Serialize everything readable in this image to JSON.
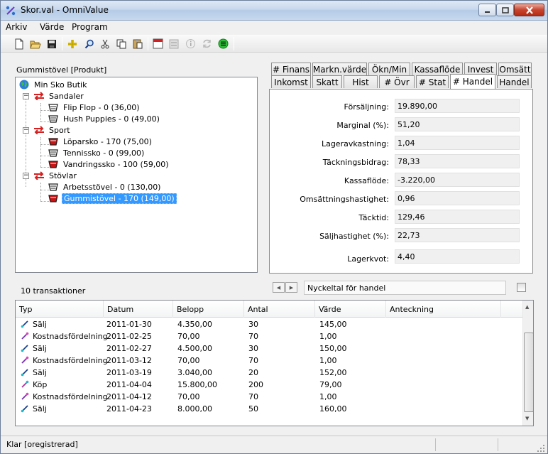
{
  "window": {
    "title": "Skor.val - OmniValue"
  },
  "menu": [
    "Arkiv",
    "Värde",
    "Program"
  ],
  "tree": {
    "caption": "Gummistövel  [Produkt]",
    "root": "Min Sko Butik",
    "groups": [
      {
        "label": "Sandaler",
        "items": [
          "Flip Flop - 0 (36,00)",
          "Hush Puppies - 0 (49,00)"
        ]
      },
      {
        "label": "Sport",
        "items": [
          "Löparsko - 170 (75,00)",
          "Tennissko - 0 (99,00)",
          "Vandringssko - 100 (59,00)"
        ]
      },
      {
        "label": "Stövlar",
        "items": [
          "Arbetsstövel - 0 (130,00)",
          "Gummistövel - 170 (149,00)"
        ]
      }
    ]
  },
  "tabs": {
    "row1": [
      "# Finans",
      "Markn.värde",
      "Ökn/Min",
      "Kassaflöde",
      "Invest",
      "Omsätt"
    ],
    "row2": [
      "Inkomst",
      "Skatt",
      "Hist",
      "# Övr",
      "# Stat",
      "# Handel",
      "Handel"
    ],
    "active": "# Handel"
  },
  "metrics": [
    {
      "label": "Försäljning:",
      "value": "19.890,00"
    },
    {
      "label": "Marginal (%):",
      "value": "51,20"
    },
    {
      "label": "Lageravkastning:",
      "value": "1,04"
    },
    {
      "label": "Täckningsbidrag:",
      "value": "78,33"
    },
    {
      "label": "Kassaflöde:",
      "value": "-3.220,00"
    },
    {
      "label": "Omsättningshastighet:",
      "value": "0,96"
    },
    {
      "label": "Täcktid:",
      "value": "129,46"
    },
    {
      "label": "Säljhastighet (%):",
      "value": "22,73"
    },
    {
      "label": "Lagerkvot:",
      "value": "4,40"
    }
  ],
  "transactions": {
    "count_label": "10 transaktioner",
    "metric_caption": "Nyckeltal för handel",
    "columns": [
      "Typ",
      "Datum",
      "Belopp",
      "Antal",
      "Värde",
      "Anteckning"
    ],
    "rows": [
      {
        "type": "Sälj",
        "icon": "sell-icon",
        "date": "2011-01-30",
        "amount": "4.350,00",
        "qty": "30",
        "value": "145,00",
        "note": ""
      },
      {
        "type": "Kostnadsfördelning",
        "icon": "cost-icon",
        "date": "2011-02-25",
        "amount": "70,00",
        "qty": "70",
        "value": "1,00",
        "note": ""
      },
      {
        "type": "Sälj",
        "icon": "sell-icon",
        "date": "2011-02-27",
        "amount": "4.500,00",
        "qty": "30",
        "value": "150,00",
        "note": ""
      },
      {
        "type": "Kostnadsfördelning",
        "icon": "cost-icon",
        "date": "2011-03-12",
        "amount": "70,00",
        "qty": "70",
        "value": "1,00",
        "note": ""
      },
      {
        "type": "Sälj",
        "icon": "sell-icon",
        "date": "2011-03-19",
        "amount": "3.040,00",
        "qty": "20",
        "value": "152,00",
        "note": ""
      },
      {
        "type": "Köp",
        "icon": "buy-icon",
        "date": "2011-04-04",
        "amount": "15.800,00",
        "qty": "200",
        "value": "79,00",
        "note": ""
      },
      {
        "type": "Kostnadsfördelning",
        "icon": "cost-icon",
        "date": "2011-04-12",
        "amount": "70,00",
        "qty": "70",
        "value": "1,00",
        "note": ""
      },
      {
        "type": "Sälj",
        "icon": "sell-icon",
        "date": "2011-04-23",
        "amount": "8.000,00",
        "qty": "50",
        "value": "160,00",
        "note": ""
      }
    ]
  },
  "status": {
    "text": "Klar [oregistrerad]"
  },
  "colors": {
    "selection": "#3399ff",
    "arrow_red": "#d42020",
    "shoe_red": "#c81414"
  }
}
